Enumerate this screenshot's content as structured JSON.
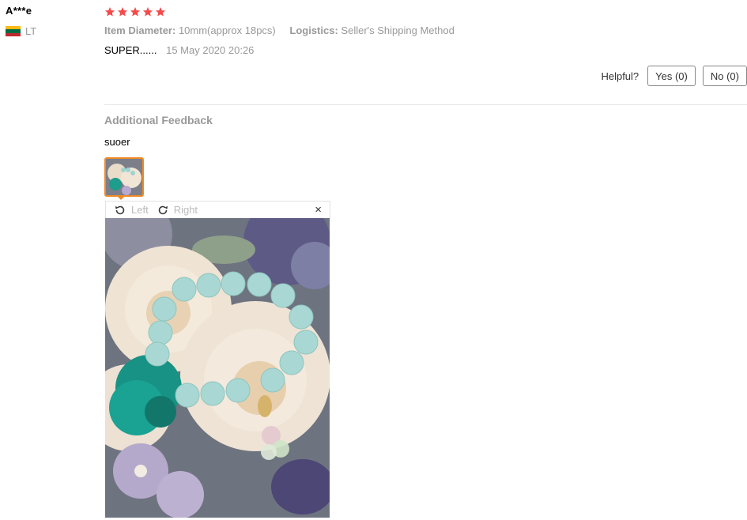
{
  "reviewer": {
    "name": "A***e",
    "country_code": "LT",
    "flag_colors": [
      "#fdb913",
      "#006a44",
      "#c1272d"
    ]
  },
  "review": {
    "rating": 5,
    "star_color": "#f44b4b",
    "attributes": [
      {
        "label": "Item Diameter:",
        "value": "10mm(approx 18pcs)"
      },
      {
        "label": "Logistics:",
        "value": "Seller's Shipping Method"
      }
    ],
    "text": "SUPER......",
    "date": "15 May 2020 20:26"
  },
  "helpful": {
    "label": "Helpful?",
    "yes": "Yes (0)",
    "no": "No (0)"
  },
  "additional_feedback": {
    "heading": "Additional Feedback",
    "text": "suoer"
  },
  "viewer": {
    "rotate_left_label": "Left",
    "rotate_right_label": "Right",
    "close_icon": "×",
    "accent_color": "#f08a24"
  }
}
